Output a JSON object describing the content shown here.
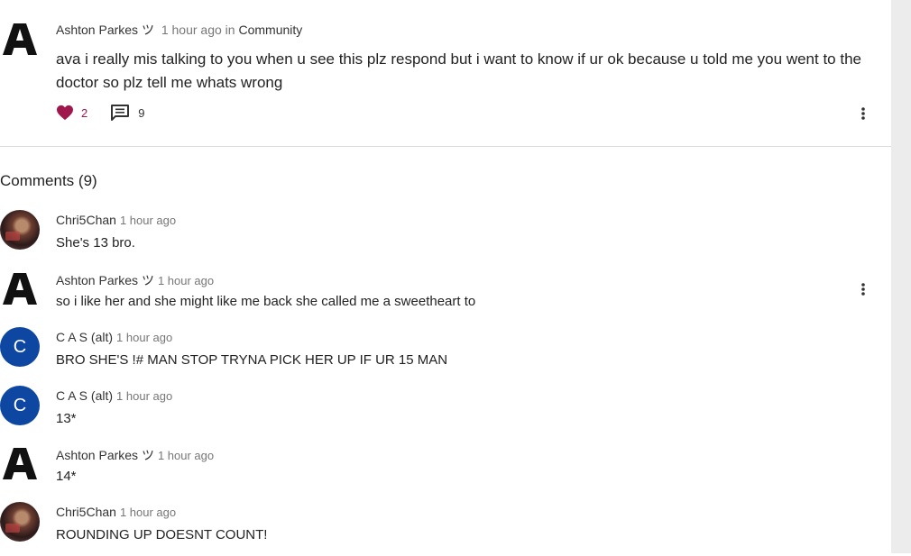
{
  "post": {
    "author": "Ashton Parkes ツ",
    "time": "1 hour ago",
    "in_label": "in",
    "community": "Community",
    "body": "ava i really mis talking to you when u see this plz respond but i want to know if ur ok because u told me you went to the doctor so plz tell me whats wrong",
    "likes": "2",
    "comments": "9",
    "like_color": "#a0174e"
  },
  "comments_header": "Comments (9)",
  "comments": [
    {
      "author": "Chri5Chan",
      "time": "1 hour ago",
      "text": "She's 13 bro.",
      "avatar": "photo"
    },
    {
      "author": "Ashton Parkes ツ",
      "time": "1 hour ago",
      "text": "so i like her and she might like me back she called me a sweetheart to",
      "avatar": "A"
    },
    {
      "author": "C A S (alt)",
      "time": "1 hour ago",
      "text": "BRO SHE'S !# MAN STOP TRYNA PICK HER UP IF UR 15 MAN",
      "avatar": "C"
    },
    {
      "author": "C A S (alt)",
      "time": "1 hour ago",
      "text": "13*",
      "avatar": "C"
    },
    {
      "author": "Ashton Parkes ツ",
      "time": "1 hour ago",
      "text": "14*",
      "avatar": "A"
    },
    {
      "author": "Chri5Chan",
      "time": "1 hour ago",
      "text": "ROUNDING UP DOESNT COUNT!",
      "avatar": "photo"
    }
  ]
}
